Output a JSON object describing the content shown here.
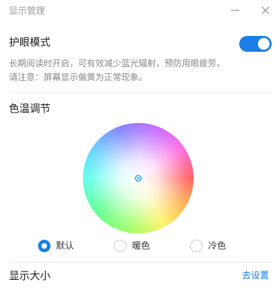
{
  "window": {
    "title": "显示管理",
    "minimize_icon": "minimize-icon",
    "close_icon": "close-icon"
  },
  "eye_protection": {
    "title": "护眼模式",
    "enabled": true,
    "description_line1": "长期阅读时开启，可有效减少蓝光辐射，预防用眼疲劳。",
    "description_line2": "请注意：屏幕显示偏黄为正常现象。"
  },
  "color_temperature": {
    "title": "色温调节",
    "options": [
      {
        "label": "默认",
        "selected": true
      },
      {
        "label": "暖色",
        "selected": false
      },
      {
        "label": "冷色",
        "selected": false
      }
    ]
  },
  "display_size": {
    "title": "显示大小",
    "link": "去设置"
  },
  "colors": {
    "accent": "#1a7ee6",
    "title_gray": "#9a9a9a",
    "text": "#1a1a1a",
    "desc": "#888888",
    "divider": "#e8e8e8"
  }
}
